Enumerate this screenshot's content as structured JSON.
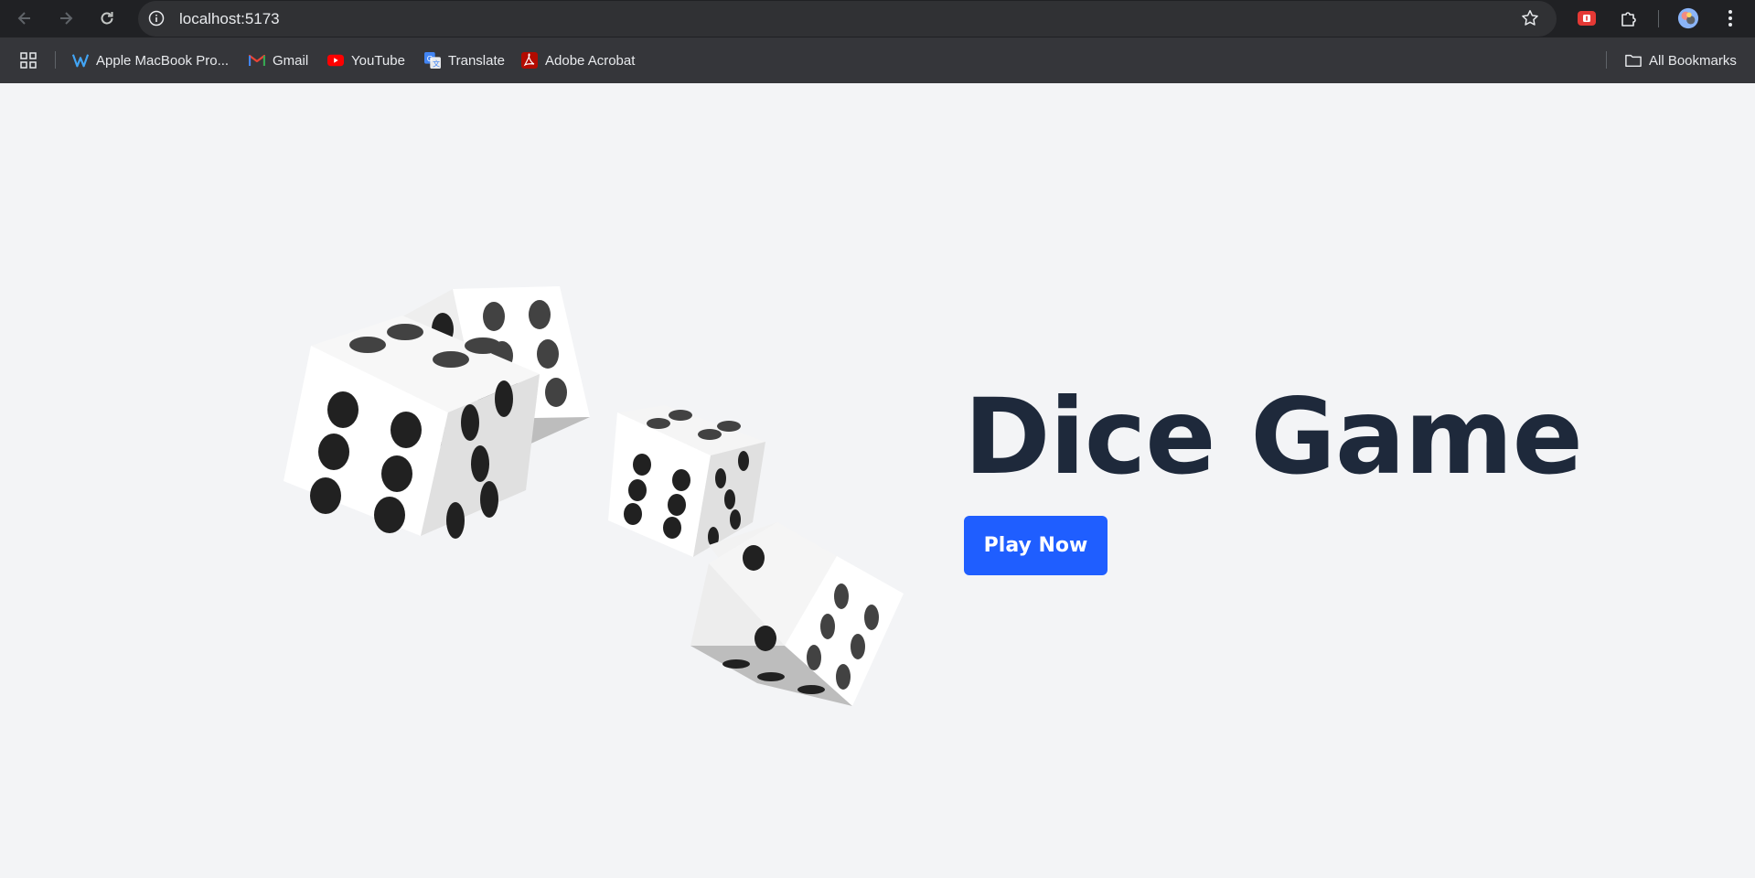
{
  "browser": {
    "url": "localhost:5173",
    "bookmarks": [
      {
        "label": "Apple MacBook Pro...",
        "icon": "macbook-favicon"
      },
      {
        "label": "Gmail",
        "icon": "gmail-icon"
      },
      {
        "label": "YouTube",
        "icon": "youtube-icon"
      },
      {
        "label": "Translate",
        "icon": "translate-icon"
      },
      {
        "label": "Adobe Acrobat",
        "icon": "acrobat-icon"
      }
    ],
    "all_bookmarks_label": "All Bookmarks"
  },
  "hero": {
    "title": "Dice Game",
    "play_button_label": "Play Now"
  },
  "colors": {
    "page_background": "#f3f4f6",
    "title": "#1e293b",
    "button": "#1f5eff",
    "chrome_dark": "#202124",
    "bookmarks_bar": "#35363a"
  }
}
